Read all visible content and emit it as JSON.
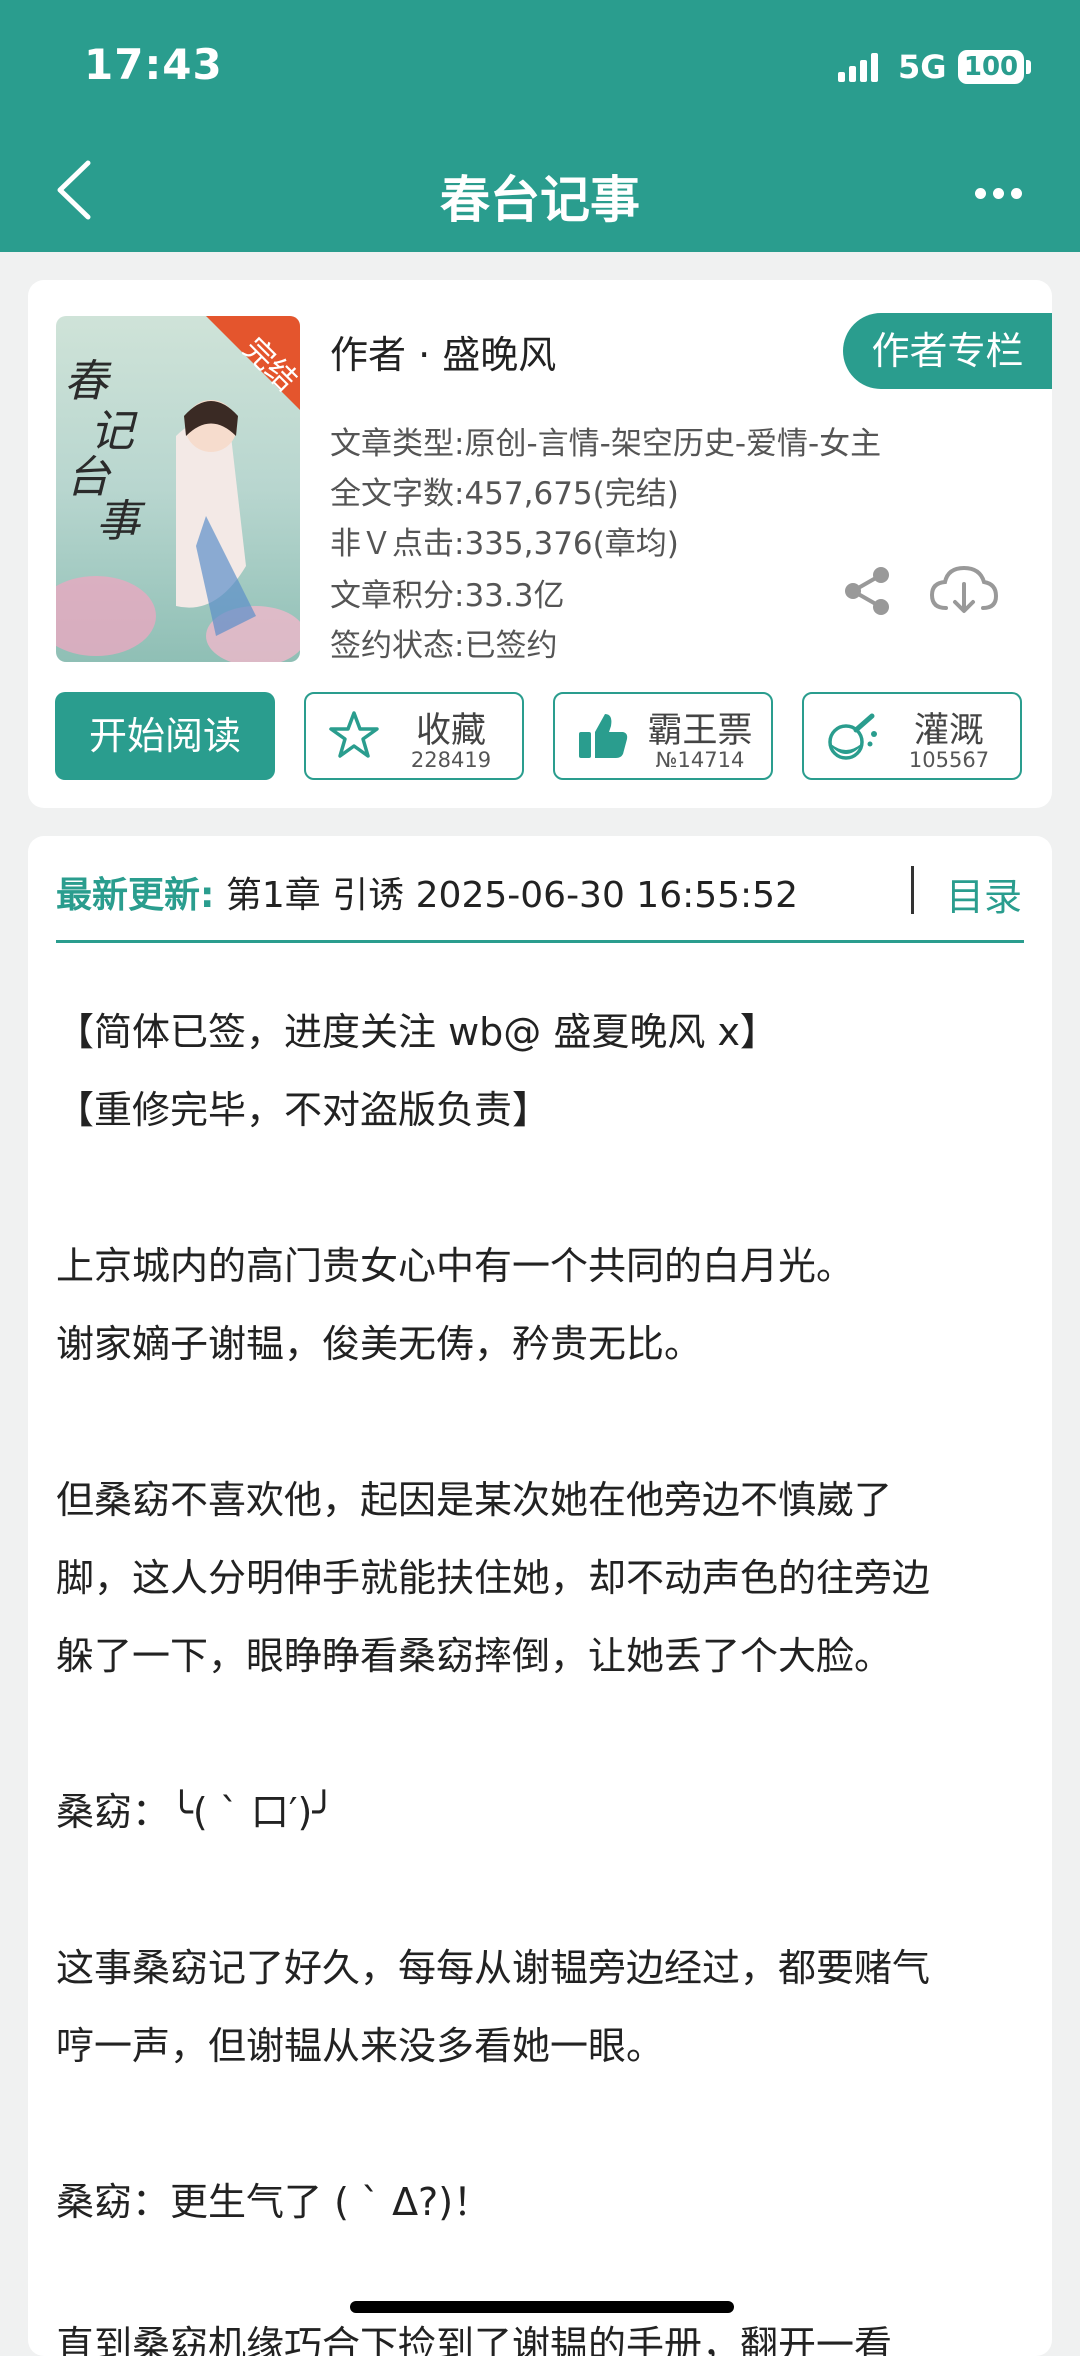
{
  "status_bar": {
    "time": "17:43",
    "network": "5G",
    "battery": "100"
  },
  "header": {
    "title": "春台记事"
  },
  "book": {
    "cover_badge": "完结",
    "author": "作者 · 盛晚风",
    "author_column_label": "作者专栏",
    "meta": [
      "文章类型:原创-言情-架空历史-爱情-女主",
      "全文字数:457,675(完结)",
      "非Ｖ点击:335,376(章均)",
      "文章积分:33.3亿",
      "签约状态:已签约"
    ]
  },
  "actions": {
    "read_label": "开始阅读",
    "favorite": {
      "label": "收藏",
      "count": "228419"
    },
    "ticket": {
      "label": "霸王票",
      "count": "№14714"
    },
    "nutrient": {
      "label": "灌溉",
      "count": "105567"
    }
  },
  "update": {
    "label": "最新更新:",
    "value": "第1章 引诱 2025-06-30 16:55:52",
    "toc_label": "目录"
  },
  "intro": [
    "【简体已签，进度关注 wb@ 盛夏晚风 x】",
    "【重修完毕，不对盗版负责】",
    "",
    "上京城内的高门贵女心中有一个共同的白月光。",
    "谢家嫡子谢韫，俊美无俦，矜贵无比。",
    "",
    "但桑窈不喜欢他，起因是某次她在他旁边不慎崴了",
    "脚，这人分明伸手就能扶住她，却不动声色的往旁边",
    "躲了一下，眼睁睁看桑窈摔倒，让她丢了个大脸。",
    "",
    "桑窈：╰( ` 口′)╯",
    "",
    "这事桑窈记了好久，每每从谢韫旁边经过，都要赌气",
    "哼一声，但谢韫从来没多看她一眼。",
    "",
    "桑窈：更生气了 ( ` Δ?)！",
    "",
    "直到桑窈机缘巧合下捡到了谢韫的手册，翻开一看"
  ]
}
